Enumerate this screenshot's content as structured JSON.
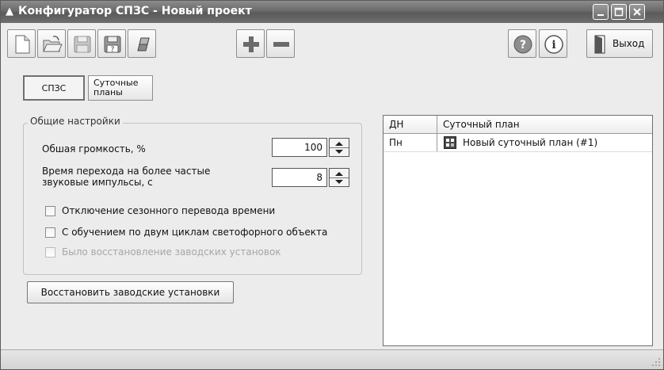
{
  "window": {
    "title": "Конфигуратор СПЗС - Новый проект",
    "title_icon": "warning-triangle-icon"
  },
  "window_controls": [
    "minimize-icon",
    "maximize-icon",
    "close-icon"
  ],
  "toolbar": {
    "buttons": [
      "new-document-icon",
      "open-folder-icon",
      "save-disk-icon",
      "save-as-disk-icon",
      "eraser-icon",
      "plus-icon",
      "minus-icon",
      "help-icon",
      "info-icon"
    ],
    "exit_label": "Выход",
    "exit_icon": "door-exit-icon"
  },
  "tabs": [
    {
      "label": "СПЗС",
      "active": true
    },
    {
      "label": "Суточные",
      "label2": "планы",
      "active": false
    }
  ],
  "general": {
    "caption": "Общие настройки",
    "volume_label": "Обшая громкость, %",
    "volume_value": "100",
    "transition_label_line1": "Время перехода на более частые",
    "transition_label_line2": "звуковые импульсы, с",
    "transition_value": "8",
    "checkboxes": [
      {
        "label": "Отключение сезонного перевода времени",
        "checked": false,
        "enabled": true
      },
      {
        "label": "С обучением по двум циклам светофорного объекта",
        "checked": false,
        "enabled": true
      },
      {
        "label": "Было восстановление заводских установок",
        "checked": false,
        "enabled": false
      }
    ]
  },
  "restore_button": "Восстановить заводские установки",
  "schedule_table": {
    "columns": [
      "ДН",
      "Суточный план"
    ],
    "rows": [
      {
        "day": "Пн",
        "plan": "Новый суточный план (#1)",
        "icon": "daily-plan-icon"
      }
    ]
  },
  "colors": {
    "titlebar": "#6a6a6a",
    "window_bg": "#ececec",
    "panel_bg": "#ffffff"
  }
}
